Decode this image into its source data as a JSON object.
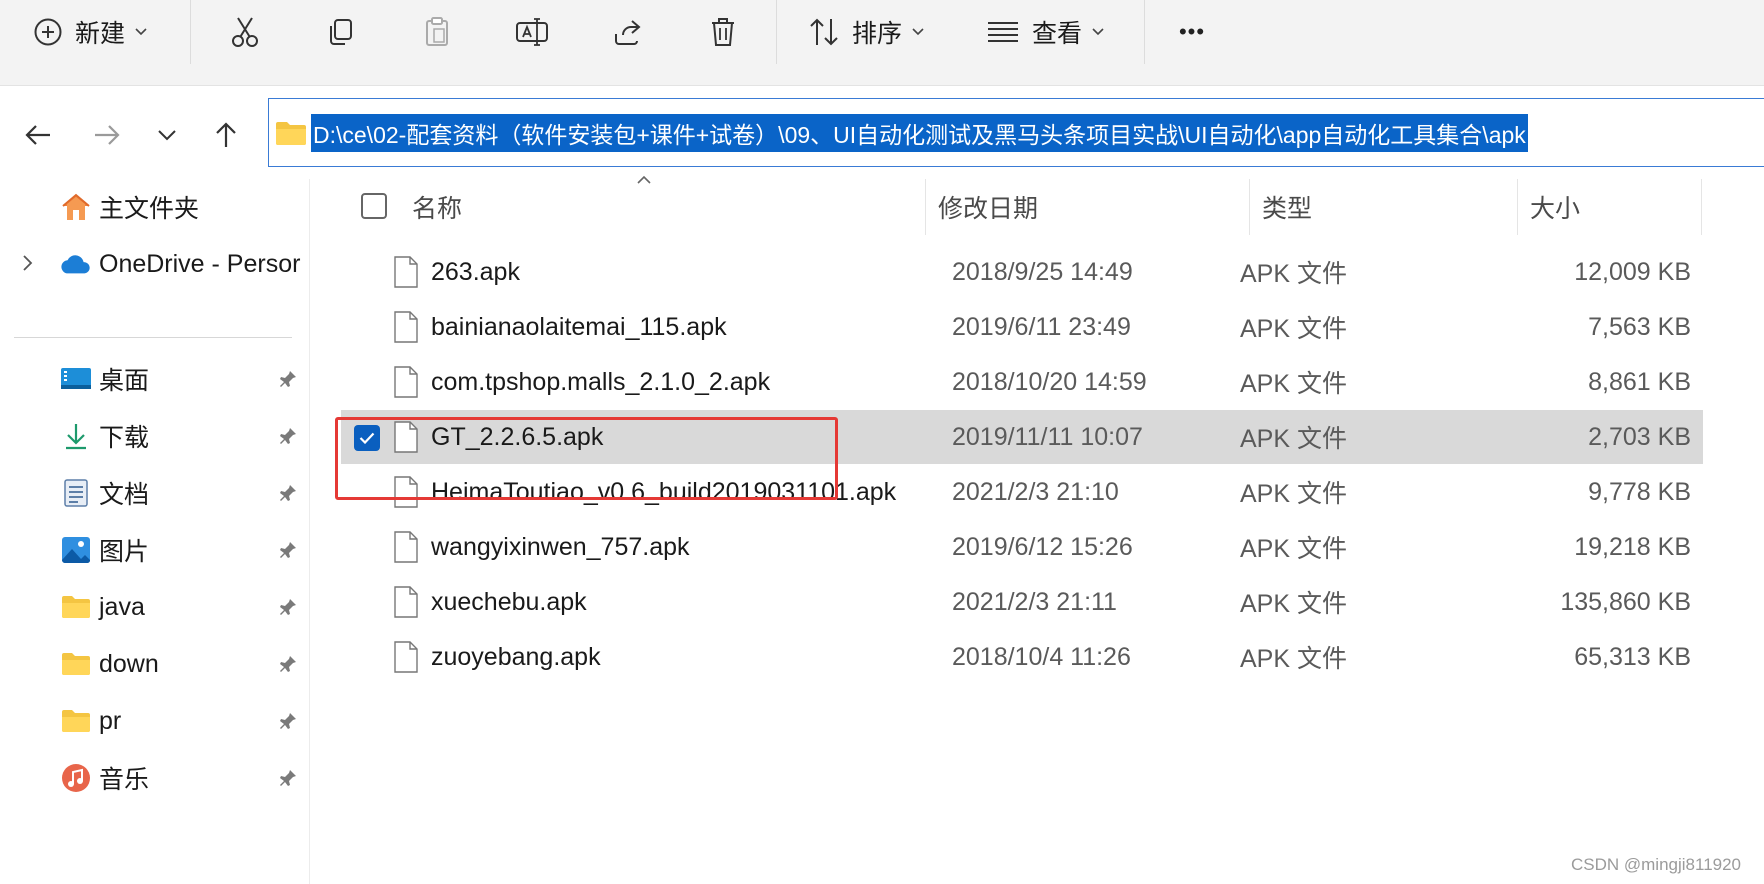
{
  "toolbar": {
    "new_label": "新建",
    "sort_label": "排序",
    "view_label": "查看",
    "more_label": "•••"
  },
  "address": {
    "path": "D:\\ce\\02-配套资料（软件安装包+课件+试卷）\\09、UI自动化测试及黑马头条项目实战\\UI自动化\\app自动化工具集合\\apk"
  },
  "sidebar": {
    "home_label": "主文件夹",
    "onedrive_label": "OneDrive - Persor",
    "items": [
      {
        "label": "桌面",
        "icon": "desktop-icon"
      },
      {
        "label": "下载",
        "icon": "download-icon"
      },
      {
        "label": "文档",
        "icon": "documents-icon"
      },
      {
        "label": "图片",
        "icon": "pictures-icon"
      },
      {
        "label": "java",
        "icon": "folder-icon"
      },
      {
        "label": "down",
        "icon": "folder-icon"
      },
      {
        "label": "pr",
        "icon": "folder-icon"
      },
      {
        "label": "音乐",
        "icon": "music-icon"
      }
    ]
  },
  "columns": {
    "name": "名称",
    "date": "修改日期",
    "type": "类型",
    "size": "大小"
  },
  "files": [
    {
      "name": "263.apk",
      "date": "2018/9/25 14:49",
      "type": "APK 文件",
      "size": "12,009 KB",
      "selected": false
    },
    {
      "name": "bainianaolaitemai_115.apk",
      "date": "2019/6/11 23:49",
      "type": "APK 文件",
      "size": "7,563 KB",
      "selected": false
    },
    {
      "name": "com.tpshop.malls_2.1.0_2.apk",
      "date": "2018/10/20 14:59",
      "type": "APK 文件",
      "size": "8,861 KB",
      "selected": false
    },
    {
      "name": "GT_2.2.6.5.apk",
      "date": "2019/11/11 10:07",
      "type": "APK 文件",
      "size": "2,703 KB",
      "selected": true
    },
    {
      "name": "HeimaToutiao_v0.6_build2019031101.apk",
      "date": "2021/2/3 21:10",
      "type": "APK 文件",
      "size": "9,778 KB",
      "selected": false
    },
    {
      "name": "wangyixinwen_757.apk",
      "date": "2019/6/12 15:26",
      "type": "APK 文件",
      "size": "19,218 KB",
      "selected": false
    },
    {
      "name": "xuechebu.apk",
      "date": "2021/2/3 21:11",
      "type": "APK 文件",
      "size": "135,860 KB",
      "selected": false
    },
    {
      "name": "zuoyebang.apk",
      "date": "2018/10/4 11:26",
      "type": "APK 文件",
      "size": "65,313 KB",
      "selected": false
    }
  ],
  "watermark": "CSDN @mingji811920",
  "colors": {
    "selection_row": "#d9d9d9",
    "highlight_box": "#e53935",
    "address_selection": "#0a64c8",
    "checkbox_checked": "#0a5fbf"
  }
}
